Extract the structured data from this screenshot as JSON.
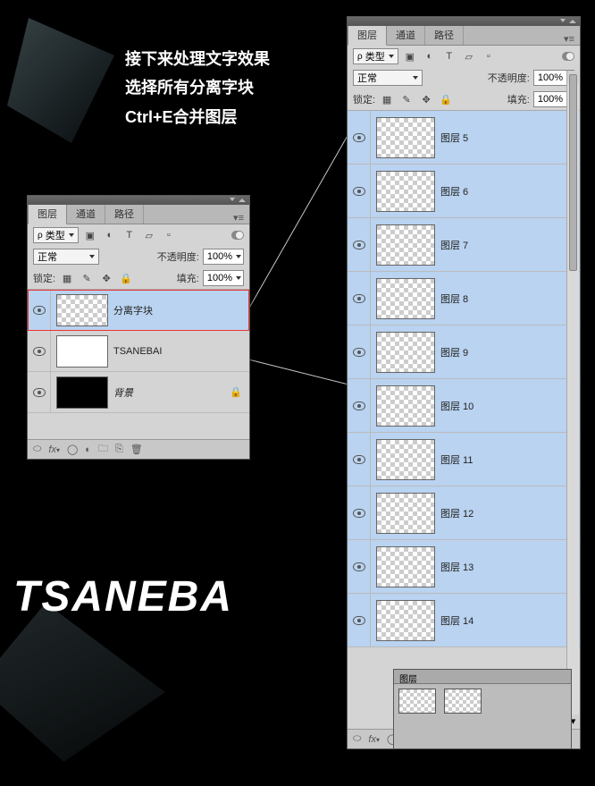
{
  "instructions": {
    "line1": "接下来处理文字效果",
    "line2": "选择所有分离字块",
    "line3": "Ctrl+E合并图层"
  },
  "artwork_text": "TSANEBA",
  "panel_tabs": {
    "layers": "图层",
    "channels": "通道",
    "paths": "路径"
  },
  "left_panel": {
    "kind_label": "类型",
    "blend_mode": "正常",
    "opacity_label": "不透明度:",
    "opacity_value": "100%",
    "lock_label": "锁定:",
    "fill_label": "填充:",
    "fill_value": "100%",
    "layers": [
      {
        "name": "分离字块",
        "thumb": "checker",
        "selected": "red",
        "visible": true
      },
      {
        "name": "TSANEBAI",
        "thumb": "white",
        "selected": "none",
        "visible": true
      },
      {
        "name": "背景",
        "thumb": "black",
        "selected": "none",
        "visible": true,
        "locked": true
      }
    ]
  },
  "right_panel": {
    "kind_label": "类型",
    "blend_mode": "正常",
    "opacity_label": "不透明度:",
    "opacity_value": "100%",
    "lock_label": "锁定:",
    "fill_label": "填充:",
    "fill_value": "100%",
    "layer_prefix": "图层",
    "layers": [
      {
        "name": "图层 5"
      },
      {
        "name": "图层 6"
      },
      {
        "name": "图层 7"
      },
      {
        "name": "图层 8"
      },
      {
        "name": "图层 9"
      },
      {
        "name": "图层 10"
      },
      {
        "name": "图层 11"
      },
      {
        "name": "图层 12"
      },
      {
        "name": "图层 13"
      },
      {
        "name": "图层 14"
      }
    ]
  },
  "icons": {
    "fx": "fx",
    "link": "⬭",
    "mask": "◯",
    "adjust": "◐",
    "folder": "🗀",
    "new": "⎘",
    "trash": "🗑",
    "menu": "▾≡",
    "filter_image": "▣",
    "filter_adjust": "◐",
    "filter_text": "T",
    "filter_shape": "▱",
    "filter_smart": "▫",
    "lock_trans": "▦",
    "lock_brush": "✎",
    "lock_move": "✥",
    "lock_all": "🔒"
  }
}
